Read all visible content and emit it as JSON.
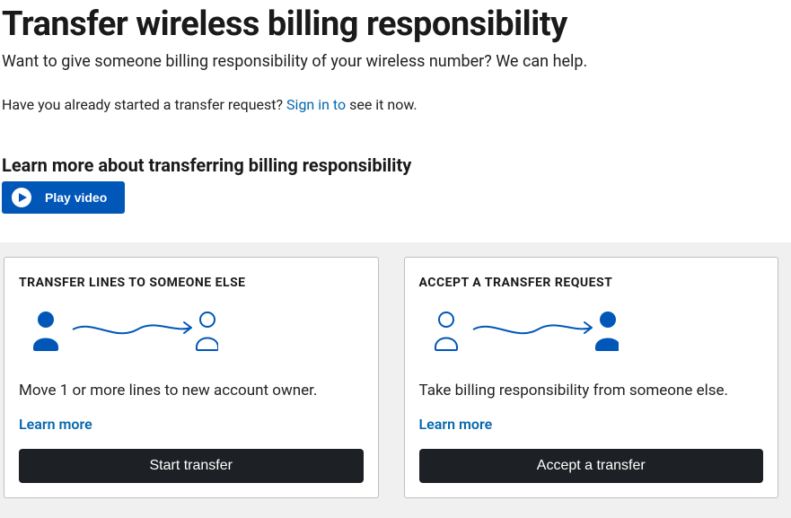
{
  "header": {
    "title": "Transfer wireless billing responsibility",
    "subhead": "Want to give someone billing responsibility of your wireless number? We can help.",
    "existing_prefix": "Have you already started a transfer request? ",
    "sign_in_label": "Sign in to",
    "existing_suffix": " see it now."
  },
  "video": {
    "heading": "Learn more about transferring billing responsibility",
    "button_label": "Play video"
  },
  "cards": {
    "transfer": {
      "title": "TRANSFER LINES TO SOMEONE ELSE",
      "desc": "Move 1 or more lines to new account owner.",
      "learn_more": "Learn more",
      "button_label": "Start transfer"
    },
    "accept": {
      "title": "ACCEPT A TRANSFER REQUEST",
      "desc": "Take billing responsibility from someone else.",
      "learn_more": "Learn more",
      "button_label": "Accept a transfer"
    }
  },
  "colors": {
    "brand_blue": "#0057b8",
    "link_blue": "#0568ae",
    "button_dark": "#1d2024"
  }
}
